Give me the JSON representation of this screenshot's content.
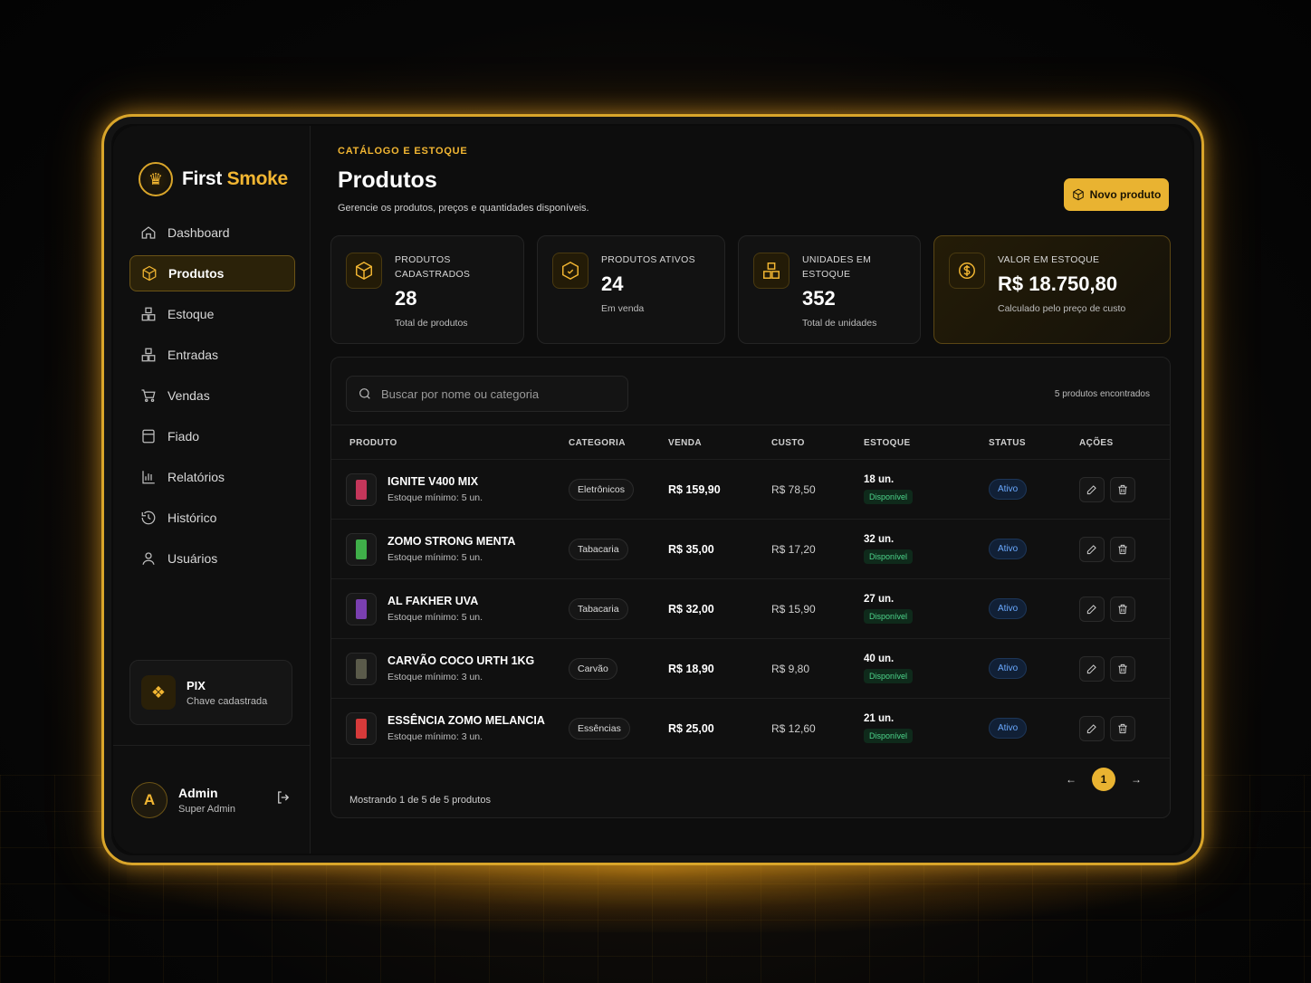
{
  "brand": {
    "first": "First",
    "second": "Smoke",
    "logo_icon": "lion-crest-icon"
  },
  "nav": [
    {
      "label": "Dashboard",
      "icon": "home-icon",
      "active": false
    },
    {
      "label": "Produtos",
      "icon": "box-icon",
      "active": true
    },
    {
      "label": "Estoque",
      "icon": "boxes-icon",
      "active": false
    },
    {
      "label": "Entradas",
      "icon": "boxes-in-icon",
      "active": false
    },
    {
      "label": "Vendas",
      "icon": "cart-icon",
      "active": false
    },
    {
      "label": "Fiado",
      "icon": "ledger-icon",
      "active": false
    },
    {
      "label": "Relatórios",
      "icon": "bar-chart-icon",
      "active": false
    },
    {
      "label": "Histórico",
      "icon": "history-icon",
      "active": false
    },
    {
      "label": "Usuários",
      "icon": "user-icon",
      "active": false
    }
  ],
  "pix": {
    "title": "PIX",
    "subtitle": "Chave cadastrada"
  },
  "user": {
    "initial": "A",
    "name": "Admin",
    "role": "Super Admin"
  },
  "header": {
    "eyebrow": "CATÁLOGO E ESTOQUE",
    "title": "Produtos",
    "subtitle": "Gerencie os produtos, preços e quantidades disponíveis.",
    "new_button": "Novo produto"
  },
  "stats": [
    {
      "label": "PRODUTOS CADASTRADOS",
      "value": "28",
      "hint": "Total de produtos",
      "icon": "box-icon"
    },
    {
      "label": "PRODUTOS ATIVOS",
      "value": "24",
      "hint": "Em venda",
      "icon": "box-check-icon"
    },
    {
      "label": "UNIDADES EM ESTOQUE",
      "value": "352",
      "hint": "Total de unidades",
      "icon": "boxes-icon"
    },
    {
      "label": "VALOR EM ESTOQUE",
      "value": "R$ 18.750,80",
      "hint": "Calculado pelo preço de custo",
      "icon": "dollar-circle-icon"
    }
  ],
  "search": {
    "placeholder": "Buscar por nome ou categoria"
  },
  "found_text": "5 produtos encontrados",
  "table": {
    "headers": [
      "PRODUTO",
      "CATEGORIA",
      "VENDA",
      "CUSTO",
      "ESTOQUE",
      "STATUS",
      "AÇÕES"
    ],
    "rows": [
      {
        "name": "IGNITE V400 MIX",
        "min": "Estoque mínimo: 5 un.",
        "category": "Eletrônicos",
        "price": "R$ 159,90",
        "cost": "R$ 78,50",
        "stock": "18 un.",
        "stock_status": "Disponível",
        "status": "Ativo",
        "thumb_color": "#c4365a"
      },
      {
        "name": "ZOMO STRONG MENTA",
        "min": "Estoque mínimo: 5 un.",
        "category": "Tabacaria",
        "price": "R$ 35,00",
        "cost": "R$ 17,20",
        "stock": "32 un.",
        "stock_status": "Disponível",
        "status": "Ativo",
        "thumb_color": "#3fae49"
      },
      {
        "name": "AL FAKHER UVA",
        "min": "Estoque mínimo: 5 un.",
        "category": "Tabacaria",
        "price": "R$ 32,00",
        "cost": "R$ 15,90",
        "stock": "27 un.",
        "stock_status": "Disponível",
        "status": "Ativo",
        "thumb_color": "#7a3fb0"
      },
      {
        "name": "CARVÃO COCO URTH 1KG",
        "min": "Estoque mínimo: 3 un.",
        "category": "Carvão",
        "price": "R$ 18,90",
        "cost": "R$ 9,80",
        "stock": "40 un.",
        "stock_status": "Disponível",
        "status": "Ativo",
        "thumb_color": "#5a5a4a"
      },
      {
        "name": "ESSÊNCIA ZOMO MELANCIA",
        "min": "Estoque mínimo: 3 un.",
        "category": "Essências",
        "price": "R$ 25,00",
        "cost": "R$ 12,60",
        "stock": "21 un.",
        "stock_status": "Disponível",
        "status": "Ativo",
        "thumb_color": "#d63a3a"
      }
    ]
  },
  "footer": {
    "showing": "Mostrando 1 de 5 de 5 produtos",
    "current_page": "1"
  },
  "colors": {
    "accent": "#e9b331",
    "success": "#4cd48a",
    "info": "#6aa9ff"
  }
}
